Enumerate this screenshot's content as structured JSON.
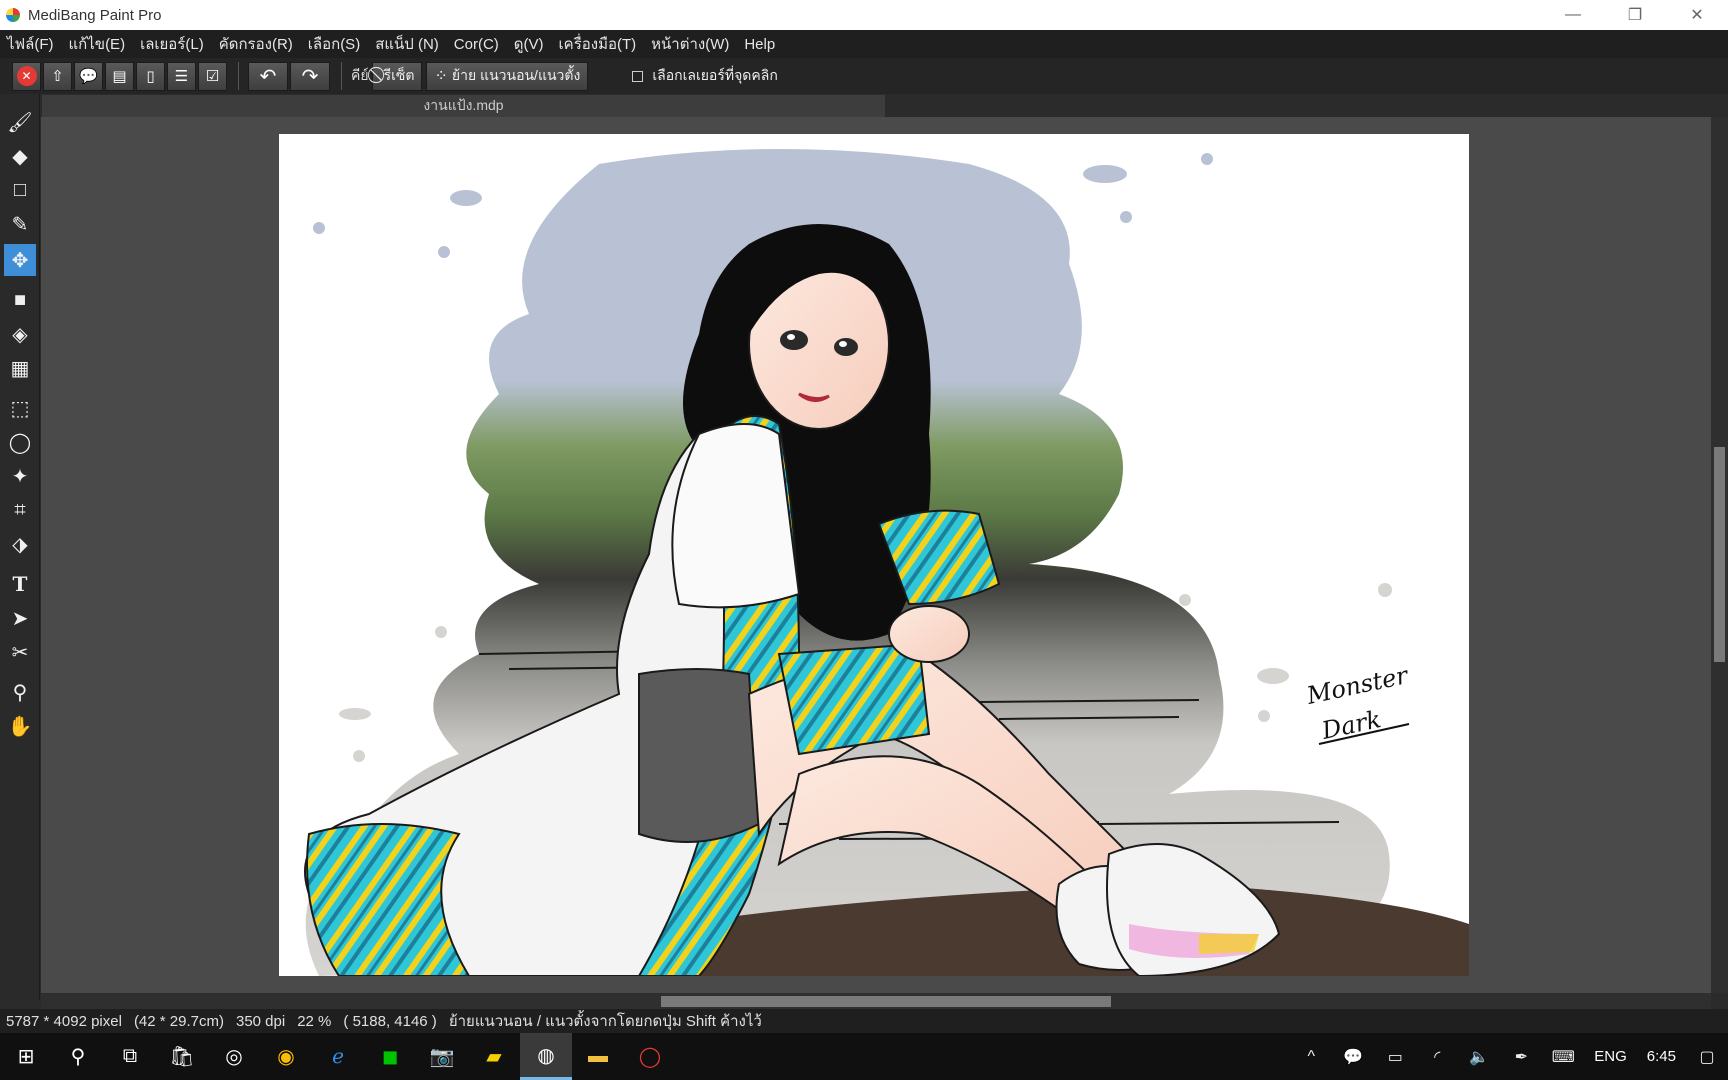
{
  "window": {
    "title": "MediBang Paint Pro",
    "minimize": "—",
    "maximize": "❐",
    "close": "✕"
  },
  "menu": [
    "ไฟล์(F)",
    "แก้ไข(E)",
    "เลเยอร์(L)",
    "คัดกรอง(R)",
    "เลือก(S)",
    "สแน็ป (N)",
    "Cor(C)",
    "ดู(V)",
    "เครื่องมือ(T)",
    "หน้าต่าง(W)",
    "Help"
  ],
  "toolbar": {
    "key_label": "คีย์",
    "reset_label": "รีเซ็ต",
    "move_mode_label": "ย้าย แนวนอน/แนวตั้ง",
    "select_layer_label": "เลือกเลเยอร์ที่จุดคลิก",
    "select_layer_checked": false
  },
  "document": {
    "tab_name": "งานแป้ง.mdp"
  },
  "artwork": {
    "signature_line1": "Monster",
    "signature_line2": "Dark"
  },
  "status": {
    "size_px": "5787 * 4092 pixel",
    "size_cm": "(42 * 29.7cm)",
    "dpi": "350 dpi",
    "zoom": "22 %",
    "cursor": "( 5188, 4146 )",
    "hint": "ย้ายแนวนอน / แนวตั้งจากโดยกดปุ่ม Shift ค้างไว้"
  },
  "taskbar": {
    "language": "ENG",
    "time": "6:45"
  },
  "colors": {
    "accent": "#3f8fd8",
    "background": "#4a4a4a",
    "sky": "#b8c2d4",
    "grass": "#6b8a4e",
    "fabric_teal": "#2fc6d8",
    "fabric_yellow": "#f2d21a"
  }
}
